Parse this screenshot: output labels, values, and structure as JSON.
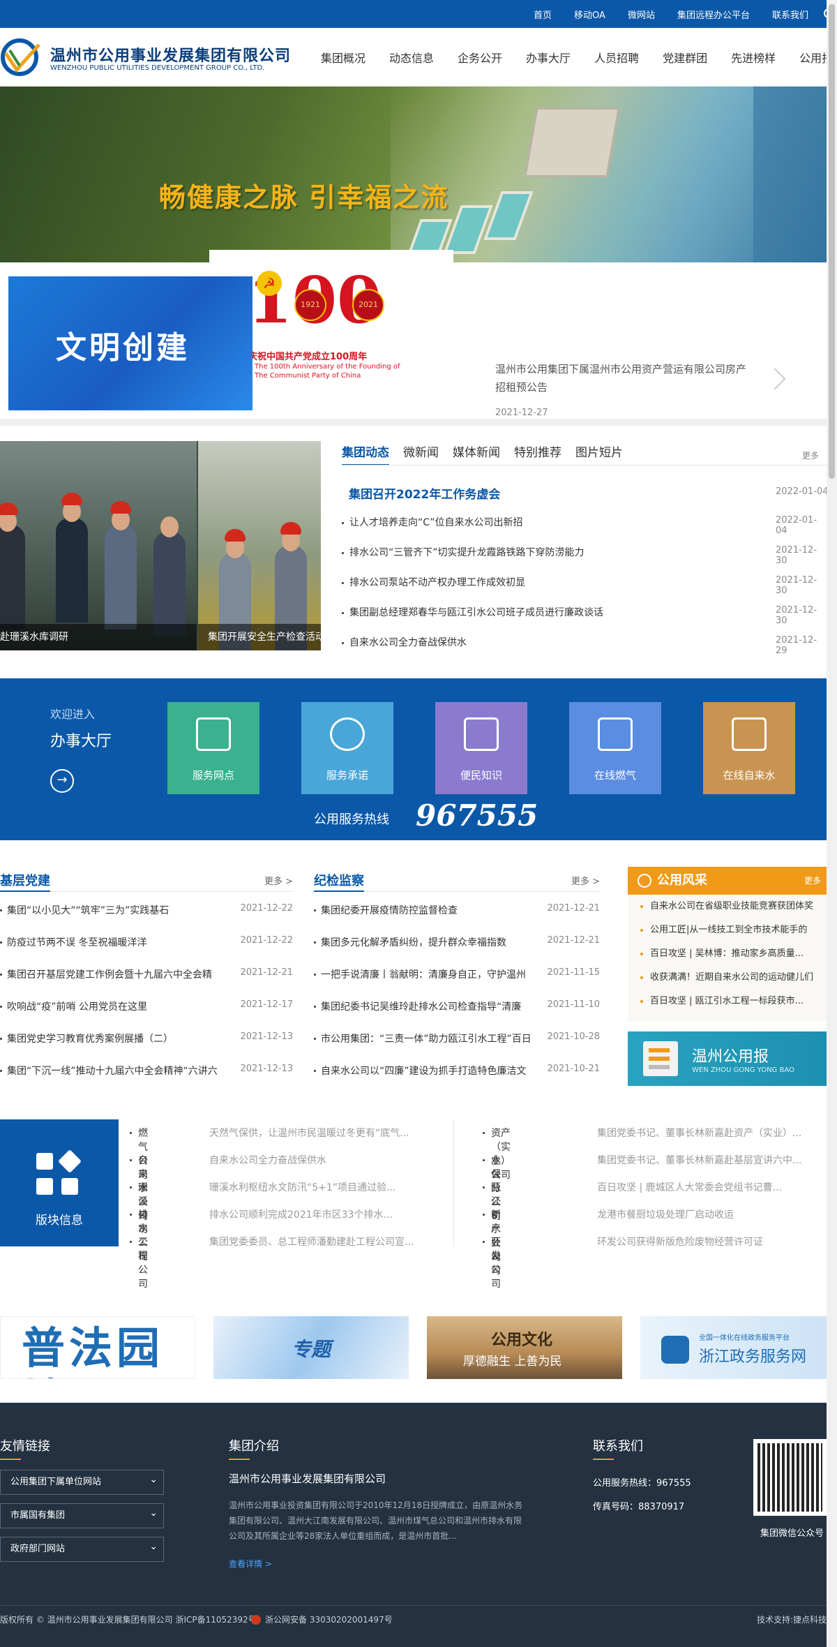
{
  "toplinks": [
    "首页",
    "移动OA",
    "微网站",
    "集团远程办公平台",
    "联系我们"
  ],
  "logo": {
    "cn": "温州市公用事业发展集团有限公司",
    "en": "WENZHOU PUBLIC UTILITIES DEVELOPMENT GROUP CO., LTD."
  },
  "nav": [
    "集团概况",
    "动态信息",
    "企务公开",
    "办事大厅",
    "人员招聘",
    "党建群团",
    "先进榜样",
    "公用报"
  ],
  "hero": {
    "slogan": "畅健康之脉  引幸福之流",
    "civ": "文明创建",
    "party_cn": "庆祝中国共产党成立100周年",
    "party_en1": "The 100th Anniversary of the Founding of",
    "party_en2": "The Communist Party of China",
    "party_num": "100",
    "y1": "1921",
    "y2": "2021",
    "notice": "温州市公用集团下属温州市公用资产营运有限公司房产招租预公告",
    "notice_date": "2021-12-27"
  },
  "photo": {
    "cap1": "赴珊溪水库调研",
    "cap2": "集团开展安全生产检查活动"
  },
  "news": {
    "tabs": [
      "集团动态",
      "微新闻",
      "媒体新闻",
      "特别推荐",
      "图片短片"
    ],
    "more": "更多",
    "headline": "集团召开2022年工作务虚会",
    "headline_date": "2022-01-04",
    "items": [
      {
        "title": "让人才培养走向“C”位自来水公司出新招",
        "date": "2022-01-04"
      },
      {
        "title": "排水公司“三管齐下”切实提升龙霞路铁路下穿防涝能力",
        "date": "2021-12-30"
      },
      {
        "title": "排水公司泵站不动产权办理工作成效初显",
        "date": "2021-12-30"
      },
      {
        "title": "集团副总经理郑春华与瓯江引水公司班子成员进行廉政谈话",
        "date": "2021-12-30"
      },
      {
        "title": "自来水公司全力奋战保供水",
        "date": "2021-12-29"
      }
    ]
  },
  "service": {
    "welcome": "欢迎进入",
    "hall": "办事大厅",
    "items": [
      {
        "label": "服务网点",
        "color": "#3bb18f"
      },
      {
        "label": "服务承诺",
        "color": "#4aa6d8"
      },
      {
        "label": "便民知识",
        "color": "#8b7bcf"
      },
      {
        "label": "在线燃气",
        "color": "#5b8de0"
      },
      {
        "label": "在线自来水",
        "color": "#c99452"
      }
    ],
    "hotline_label": "公用服务热线",
    "hotline": "967555"
  },
  "party": {
    "title": "基层党建",
    "more": "更多 >",
    "items": [
      {
        "title": "集团“以小见大”“筑牢”三为”实践基石",
        "date": "2021-12-22"
      },
      {
        "title": "防疫过节两不误 冬至祝福暖洋洋",
        "date": "2021-12-22"
      },
      {
        "title": "集团召开基层党建工作例会暨十九届六中全会精",
        "date": "2021-12-21"
      },
      {
        "title": "吹响战“疫”前哨 公用党员在这里",
        "date": "2021-12-17"
      },
      {
        "title": "集团党史学习教育优秀案例展播（二）",
        "date": "2021-12-13"
      },
      {
        "title": "集团“下沉一线”推动十九届六中全会精神“六讲六",
        "date": "2021-12-13"
      }
    ]
  },
  "discipline": {
    "title": "纪检监察",
    "more": "更多 >",
    "items": [
      {
        "title": "集团纪委开展疫情防控监督检查",
        "date": "2021-12-21"
      },
      {
        "title": "集团多元化解矛盾纠纷，提升群众幸福指数",
        "date": "2021-12-21"
      },
      {
        "title": "一把手说清廉丨翁献明：清廉身自正，守护温州",
        "date": "2021-11-15"
      },
      {
        "title": "集团纪委书记吴维玲赴排水公司检查指导“清廉",
        "date": "2021-11-10"
      },
      {
        "title": "市公用集团：“三责一体”助力瓯江引水工程”百日",
        "date": "2021-10-28"
      },
      {
        "title": "自来水公司以“四廉”建设为抓手打造特色廉洁文",
        "date": "2021-10-21"
      }
    ]
  },
  "style": {
    "title": "公用风采",
    "more": "更多",
    "items": [
      "自来水公司在省级职业技能竞赛获团体奖",
      "公用工匠|从一线技工到全市技术能手的",
      "百日攻坚 | 吴林博：推动家乡高质量...",
      "收获满满！近期自来水公司的运动健儿们",
      "百日攻坚 | 瓯江引水工程一标段获市..."
    ]
  },
  "wzb": {
    "cn": "温州公用报",
    "en": "WEN ZHOU GONG YONG BAO"
  },
  "blocks": {
    "label": "版块信息",
    "left": [
      {
        "co": "燃气公司",
        "tt": "天然气保供，让温州市民温暖过冬更有“底气..."
      },
      {
        "co": "自来水公司",
        "tt": "自来水公司全力奋战保供水"
      },
      {
        "co": "珊溪公司",
        "tt": "珊溪水利枢纽水文防汛“5+1”项目通过验..."
      },
      {
        "co": "排水公司",
        "tt": "排水公司顺利完成2021年市区33个排水..."
      },
      {
        "co": "工程公司",
        "tt": "集团党委委员、总工程师潘勤建赴工程公司宣..."
      }
    ],
    "right": [
      {
        "co": "资产（实业）公司",
        "tt": "集团党委书记、董事长林新嘉赴资产（实业）..."
      },
      {
        "co": "水保分公司",
        "tt": "集团党委书记、董事长林新嘉赴基层宣讲六中..."
      },
      {
        "co": "瓯江引水公司",
        "tt": "百日攻坚 | 鹿城区人大常委会党组书记曹..."
      },
      {
        "co": "新产业公司",
        "tt": "龙港市餐厨垃圾处理厂启动收运"
      },
      {
        "co": "环发公司",
        "tt": "环发公司获得新版危险废物经营许可证"
      }
    ]
  },
  "banners": [
    {
      "t": "普法园地",
      "c": "#ffffff"
    },
    {
      "t": "专题",
      "c": "#5aa6e6"
    },
    {
      "t": "公用文化",
      "s": "厚德融生  上善为民",
      "c": "#c59b62"
    },
    {
      "t": "浙江政务服务网",
      "s": "全国一体化在线政务服务平台",
      "c": "#3f8ed6"
    }
  ],
  "footer": {
    "links_title": "友情链接",
    "selects": [
      "公用集团下属单位网站",
      "市属国有集团",
      "政府部门网站"
    ],
    "intro_title": "集团介绍",
    "intro_name": "温州市公用事业发展集团有限公司",
    "intro": "温州市公用事业投资集团有限公司于2010年12月18日授牌成立，由原温州水务集团有限公司、温州大江南发展有限公司、温州市煤气总公司和温州市排水有限公司及其所属企业等28家法人单位重组而成，是温州市首批...",
    "intro_more": "查看详情 >",
    "contact_title": "联系我们",
    "hotline": "公用服务热线：967555",
    "fax": "传真号码：88370917",
    "qr_label": "集团微信公众号",
    "copyright": "版权所有 © 温州市公用事业发展集团有限公司 浙ICP备11052392号",
    "beian": "浙公网安备 33030202001497号",
    "tech": "技术支持:捷点科技"
  }
}
